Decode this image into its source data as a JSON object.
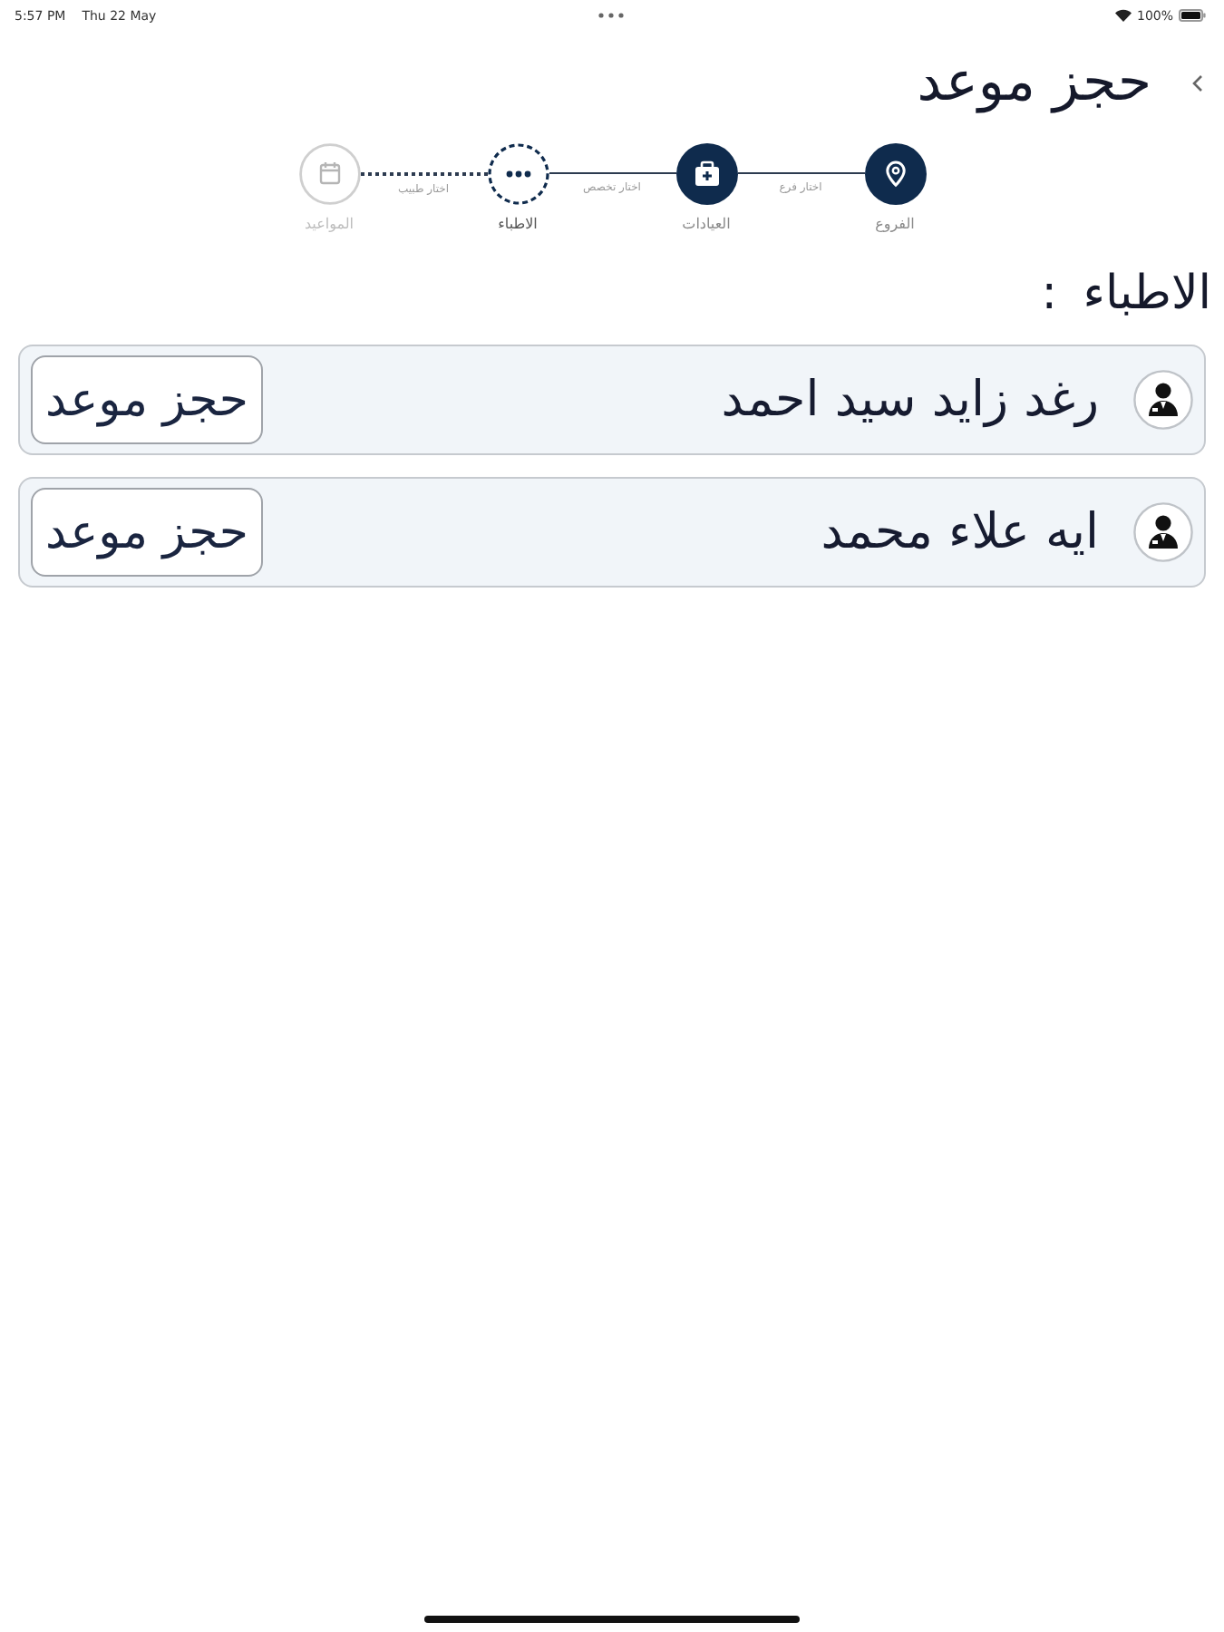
{
  "status_bar": {
    "time": "5:57 PM",
    "date": "Thu 22 May",
    "battery": "100%"
  },
  "header": {
    "title": "حجز موعد"
  },
  "stepper": {
    "steps": [
      {
        "label": "الفروع",
        "completed": true,
        "selected": false
      },
      {
        "label": "العيادات",
        "completed": true,
        "selected": false
      },
      {
        "label": "الاطباء",
        "completed": false,
        "selected": true
      },
      {
        "label": "المواعيد",
        "completed": false,
        "selected": false
      }
    ],
    "connectors": [
      {
        "label": "اختار فرع",
        "completed": true
      },
      {
        "label": "اختار تخصص",
        "completed": true
      },
      {
        "label": "اختار طبيب",
        "completed": false
      }
    ]
  },
  "section_title": "الاطباء :",
  "doctors": [
    {
      "name": "رغد زايد سيد احمد",
      "button": "حجز موعد"
    },
    {
      "name": "ايه علاء محمد",
      "button": "حجز موعد"
    }
  ]
}
